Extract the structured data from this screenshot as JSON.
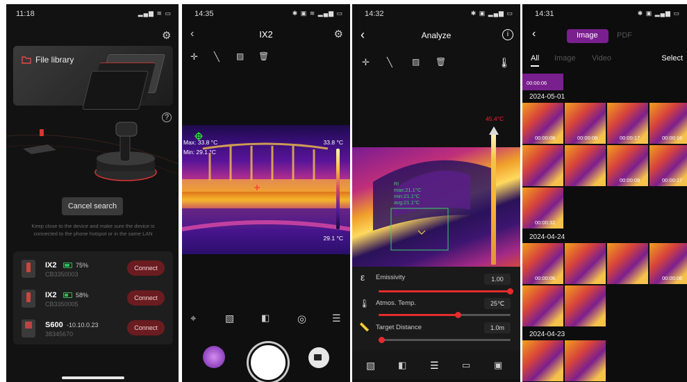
{
  "panel1": {
    "status_time": "11:18",
    "file_library": "File library",
    "cancel_search": "Cancel search",
    "hint": "Keep close to the device and make sure the device is connected to the phone hotspot or in the same LAN",
    "devices": [
      {
        "name": "IX2",
        "battery": "75%",
        "battery_level": 0.75,
        "serial": "CB3350003",
        "button": "Connect"
      },
      {
        "name": "IX2",
        "battery": "58%",
        "battery_level": 0.58,
        "serial": "CB3350005",
        "button": "Connect"
      },
      {
        "name": "S600",
        "ip": "-10.10.0.23",
        "serial": "38345670",
        "button": "Connect"
      }
    ]
  },
  "panel2": {
    "status_time": "14:35",
    "title": "IX2",
    "max": "Max: 33.8 °C",
    "min": "Min: 29.1 °C",
    "scale_top": "33.8 °C",
    "scale_bottom": "29.1 °C"
  },
  "panel3": {
    "status_time": "14:32",
    "title": "Analyze",
    "temp_max": "45.4°C",
    "overlay": [
      "Ri",
      "max:21.1°C",
      "min:21.1°C",
      "avg:21.1°C"
    ],
    "params": [
      {
        "label": "Emissivity",
        "value": "1.00",
        "level": 1.0
      },
      {
        "label": "Atmos. Temp.",
        "value": "25℃",
        "level": 0.6
      },
      {
        "label": "Target Distance",
        "value": "1.0m",
        "level": 0.02
      }
    ]
  },
  "panel4": {
    "status_time": "14:31",
    "tab_image": "Image",
    "tab_pdf": "PDF",
    "filter_all": "All",
    "filter_image": "Image",
    "filter_video": "Video",
    "select": "Select",
    "top_duration": "00:00:06",
    "groups": [
      {
        "date": "2024-05-01",
        "items": [
          "00:00:08",
          "00:00:08",
          "00:00:17",
          "00:00:16",
          "",
          "",
          "00:00:09",
          "00:00:17",
          "00:00:32"
        ]
      },
      {
        "date": "2024-04-24",
        "items": [
          "00:00:06",
          "",
          "",
          "00:00:06",
          "",
          ""
        ]
      },
      {
        "date": "2024-04-23",
        "items": [
          "",
          ""
        ]
      }
    ]
  },
  "colors": {
    "accent_red": "#e52b2b",
    "connect_bg": "#6a1c20",
    "purple_tab": "#7a1f8e"
  }
}
